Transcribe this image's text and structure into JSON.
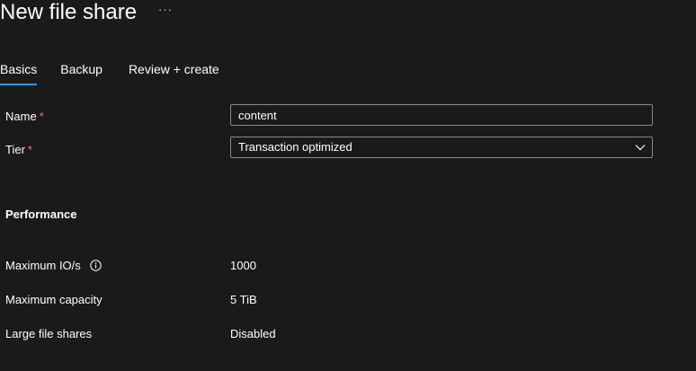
{
  "header": {
    "title": "New file share",
    "more_label": "···"
  },
  "tabs": [
    {
      "label": "Basics",
      "active": true
    },
    {
      "label": "Backup",
      "active": false
    },
    {
      "label": "Review + create",
      "active": false
    }
  ],
  "form": {
    "name": {
      "label": "Name",
      "required_mark": "*",
      "value": "content"
    },
    "tier": {
      "label": "Tier",
      "required_mark": "*",
      "value": "Transaction optimized"
    }
  },
  "performance": {
    "heading": "Performance",
    "rows": [
      {
        "label": "Maximum IO/s",
        "value": "1000",
        "has_info": true
      },
      {
        "label": "Maximum capacity",
        "value": "5 TiB"
      },
      {
        "label": "Large file shares",
        "value": "Disabled"
      }
    ]
  },
  "icons": {
    "more": "more-icon",
    "chevron": "chevron-down-icon",
    "info": "info-icon"
  },
  "colors": {
    "background": "#1b1a19",
    "accent": "#2899f5",
    "required": "#f1707b",
    "border": "#8a8886"
  }
}
